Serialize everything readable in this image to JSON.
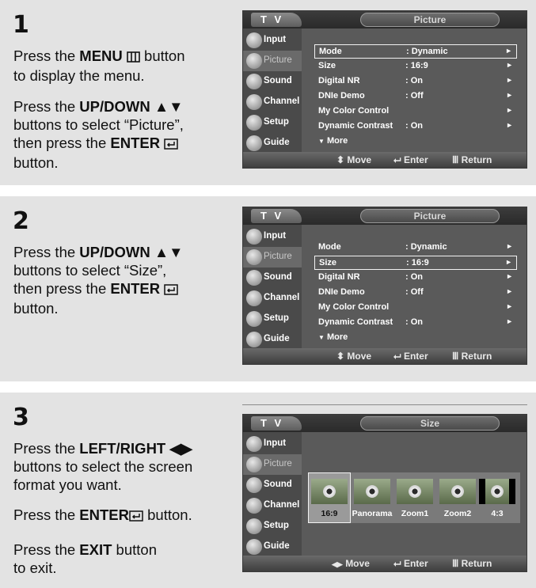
{
  "steps": [
    {
      "number": "1",
      "lines": [
        {
          "parts": [
            "Press the ",
            "MENU",
            " ",
            "",
            " button"
          ]
        },
        {
          "parts": [
            "to display the menu."
          ]
        }
      ],
      "lines2": [
        {
          "parts": [
            "Press the ",
            "UP/DOWN",
            " ▲▼"
          ]
        },
        {
          "parts": [
            "buttons to select “Picture”,"
          ]
        },
        {
          "parts": [
            "then press the ",
            "ENTER",
            ""
          ]
        },
        {
          "parts": [
            "button."
          ]
        }
      ]
    },
    {
      "number": "2",
      "lines": [
        {
          "parts": [
            "Press the ",
            "UP/DOWN",
            " ▲▼"
          ]
        },
        {
          "parts": [
            "buttons to select “Size”,"
          ]
        },
        {
          "parts": [
            "then press the ",
            "ENTER",
            ""
          ]
        },
        {
          "parts": [
            "button."
          ]
        }
      ]
    },
    {
      "number": "3",
      "lines": [
        {
          "parts": [
            "Press the ",
            "LEFT/RIGHT",
            " ◀▶"
          ]
        },
        {
          "parts": [
            "buttons to select the screen"
          ]
        },
        {
          "parts": [
            "format you want."
          ]
        }
      ],
      "lines2": [
        {
          "parts": [
            "Press the ",
            "ENTER",
            "  button."
          ]
        }
      ],
      "lines3": [
        {
          "parts": [
            "Press the ",
            "EXIT",
            " button"
          ]
        },
        {
          "parts": [
            "to exit."
          ]
        }
      ]
    }
  ],
  "tv": {
    "label": "T V",
    "sidebar": [
      "Input",
      "Picture",
      "Sound",
      "Channel",
      "Setup",
      "Guide"
    ],
    "picture_menu": {
      "title": "Picture",
      "rows": [
        {
          "label": "Mode",
          "value": ": Dynamic"
        },
        {
          "label": "Size",
          "value": ": 16:9"
        },
        {
          "label": "Digital NR",
          "value": ": On"
        },
        {
          "label": "DNIe Demo",
          "value": ": Off"
        },
        {
          "label": "My Color Control",
          "value": ""
        },
        {
          "label": "Dynamic Contrast",
          "value": ": On"
        }
      ],
      "more": "More",
      "arrow": "►"
    },
    "size_menu": {
      "title": "Size",
      "options": [
        "16:9",
        "Panorama",
        "Zoom1",
        "Zoom2",
        "4:3"
      ],
      "selected": "16:9"
    },
    "bottom": {
      "move": "Move",
      "enter": "Enter",
      "return": "Return",
      "updown_glyph": "◆",
      "leftright_glyph": "◀▶"
    }
  }
}
